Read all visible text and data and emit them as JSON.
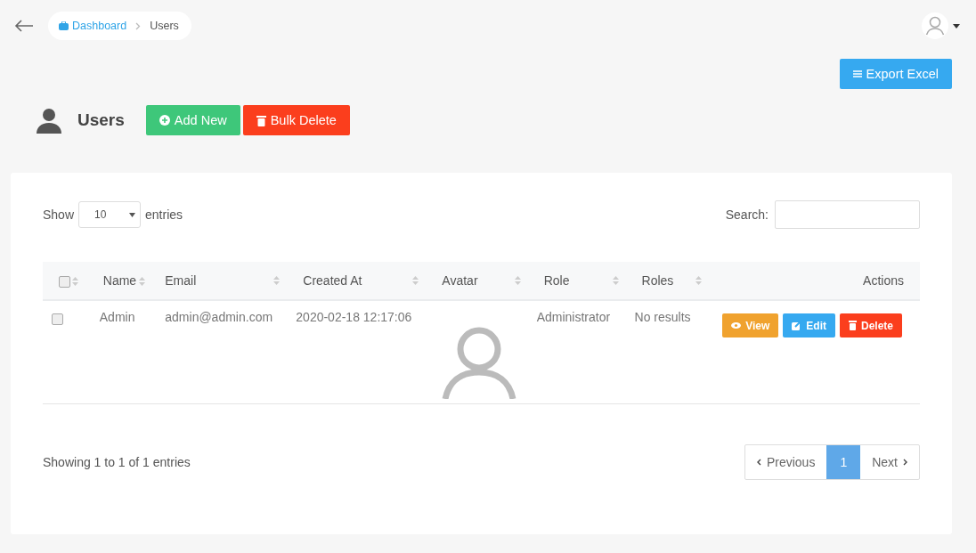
{
  "breadcrumb": [
    {
      "label": "Dashboard",
      "kind": "link"
    },
    {
      "label": "Users",
      "kind": "current"
    }
  ],
  "page_title": "Users",
  "header_buttons": [
    {
      "label": "Add New",
      "kind": "add"
    },
    {
      "label": "Bulk Delete",
      "kind": "delete"
    }
  ],
  "export_button": "Export Excel",
  "length_control": {
    "before": "Show",
    "value": "10",
    "after": "entries"
  },
  "search": {
    "label": "Search:"
  },
  "table": {
    "select_all_checked": false,
    "columns": [
      {
        "label": "Name",
        "sortable": true
      },
      {
        "label": "Email",
        "sortable": true
      },
      {
        "label": "Created At",
        "sortable": true
      },
      {
        "label": "Avatar",
        "sortable": true
      },
      {
        "label": "Role",
        "sortable": true
      },
      {
        "label": "Roles",
        "sortable": true
      },
      {
        "label": "Actions",
        "sortable": false
      }
    ],
    "rows": [
      {
        "checked": false,
        "name": "Admin",
        "email": "admin@admin.com",
        "created_at": "2020-02-18 12:17:06",
        "role": "Administrator",
        "roles": "No results",
        "actions": [
          {
            "label": "View",
            "kind": "view"
          },
          {
            "label": "Edit",
            "kind": "edit"
          },
          {
            "label": "Delete",
            "kind": "delete"
          }
        ]
      }
    ]
  },
  "info": "Showing 1 to 1 of 1 entries",
  "pagination": [
    {
      "label": "Previous",
      "kind": "prev",
      "selected": false
    },
    {
      "label": "1",
      "kind": "page",
      "selected": true
    },
    {
      "label": "Next",
      "kind": "next",
      "selected": false
    }
  ]
}
